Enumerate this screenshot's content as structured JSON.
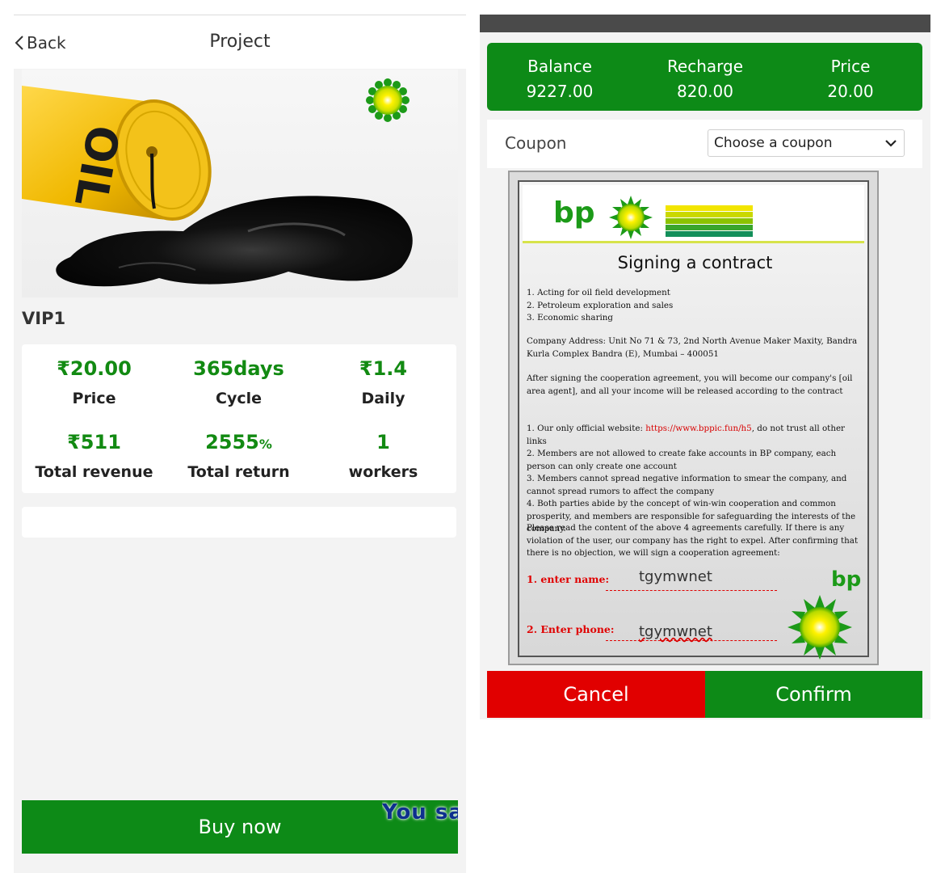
{
  "left": {
    "header": {
      "back_label": "Back",
      "title": "Project"
    },
    "product": {
      "image_alt": "OIL",
      "name": "VIP1"
    },
    "stats": [
      {
        "value": "₹20.00",
        "label": "Price"
      },
      {
        "value": "365days",
        "label": "Cycle"
      },
      {
        "value": "₹1.4",
        "label": "Daily"
      },
      {
        "value": "₹511",
        "label": "Total revenue"
      },
      {
        "value": "2555",
        "unit": "%",
        "label": "Total return"
      },
      {
        "value": "1",
        "label": "workers"
      }
    ],
    "buy_label": "Buy now",
    "marquee_text": "You sa"
  },
  "right": {
    "balance": {
      "label": "Balance",
      "value": "9227.00"
    },
    "recharge": {
      "label": "Recharge",
      "value": "820.00"
    },
    "price": {
      "label": "Price",
      "value": "20.00"
    },
    "coupon": {
      "label": "Coupon",
      "selected": "Choose a coupon"
    },
    "contract": {
      "logo_text": "bp",
      "title": "Signing a contract",
      "items": [
        "1. Acting for oil field development",
        "2. Petroleum exploration and sales",
        "3. Economic sharing"
      ],
      "address": "Company Address: Unit No 71 & 73, 2nd North Avenue Maker Maxity, Bandra Kurla Complex Bandra (E), Mumbai – 400051",
      "agreement_intro": "After signing the cooperation agreement, you will become our company's [oil area agent], and all your income will be released according to the contract",
      "rule1_prefix": "1. Our only official website: ",
      "rule1_link": "https://www.bppic.fun/h5",
      "rule1_suffix": ", do not trust all other links",
      "rule2": "2. Members are not allowed to create fake accounts in BP company, each person can only create one account",
      "rule3": "3. Members cannot spread negative information to smear the company, and cannot spread rumors to affect the company",
      "rule4": "4. Both parties abide by the concept of win-win cooperation and common prosperity, and members are responsible for safeguarding the interests of the company.",
      "closing": "Please read the content of the above 4 agreements carefully. If there is any violation of the user, our company has the right to expel. After confirming that there is no objection, we will sign a cooperation agreement:",
      "name_label": "1. enter name:",
      "name_value": "tgymwnet",
      "phone_label": "2. Enter phone:",
      "phone_value": "tgymwnet",
      "logo_text_small": "bp"
    },
    "cancel_label": "Cancel",
    "confirm_label": "Confirm"
  },
  "colors": {
    "brand_green": "#0d8a17",
    "value_green": "#128a12",
    "cancel_red": "#e10000",
    "bp_green": "#1c9a18",
    "bp_yellow": "#f7e70a"
  },
  "icons": [
    "chevron-left-icon",
    "bp-helios-logo-icon",
    "chevron-down-icon",
    "oil-barrel-image"
  ]
}
